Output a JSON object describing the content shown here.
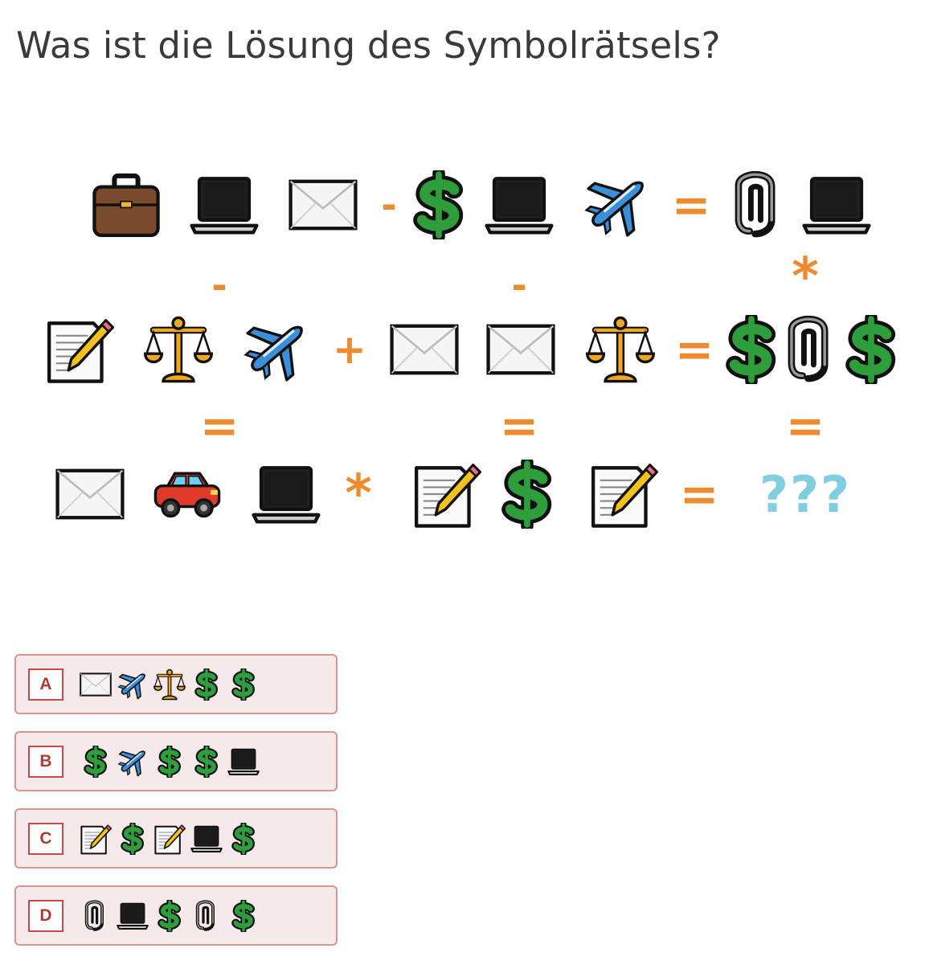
{
  "question": "Was ist die Lösung des Symbolrätsels?",
  "unknown": "???",
  "operators": {
    "minus": "-",
    "plus": "+",
    "times": "*",
    "equals": "="
  },
  "options": [
    {
      "letter": "A",
      "symbols": [
        "envelope-icon",
        "airplane-icon",
        "scales-icon",
        "dollar-icon",
        "dollar-icon"
      ]
    },
    {
      "letter": "B",
      "symbols": [
        "dollar-icon",
        "airplane-icon",
        "dollar-icon",
        "dollar-icon",
        "laptop-icon"
      ]
    },
    {
      "letter": "C",
      "symbols": [
        "memo-icon",
        "dollar-icon",
        "memo-icon",
        "laptop-icon",
        "dollar-icon"
      ]
    },
    {
      "letter": "D",
      "symbols": [
        "paperclip-icon",
        "laptop-icon",
        "dollar-icon",
        "paperclip-icon",
        "dollar-icon"
      ]
    }
  ],
  "puzzle": {
    "row1": [
      "briefcase-icon",
      "laptop-icon",
      "envelope-icon",
      "minus",
      "dollar-icon",
      "laptop-icon",
      "airplane-icon",
      "equals",
      "paperclip-icon",
      "laptop-icon"
    ],
    "row2": [
      "memo-icon",
      "scales-icon",
      "airplane-icon",
      "plus",
      "envelope-icon",
      "envelope-icon",
      "scales-icon",
      "equals",
      "dollar-icon",
      "paperclip-icon",
      "dollar-icon"
    ],
    "row3": [
      "envelope-icon",
      "car-icon",
      "laptop-icon",
      "times",
      "memo-icon",
      "dollar-icon",
      "memo-icon",
      "equals",
      "unknown"
    ],
    "col_ops_1": [
      "minus",
      "minus",
      "times"
    ],
    "col_ops_2": [
      "equals",
      "equals",
      "equals"
    ]
  },
  "colors": {
    "operator": "#ee8b2f",
    "dollar": "#2e9e3c",
    "unknown": "#7fcfe0",
    "option_bg": "#f6e9e9",
    "option_border": "#d8948f",
    "letter_border": "#c94949"
  }
}
